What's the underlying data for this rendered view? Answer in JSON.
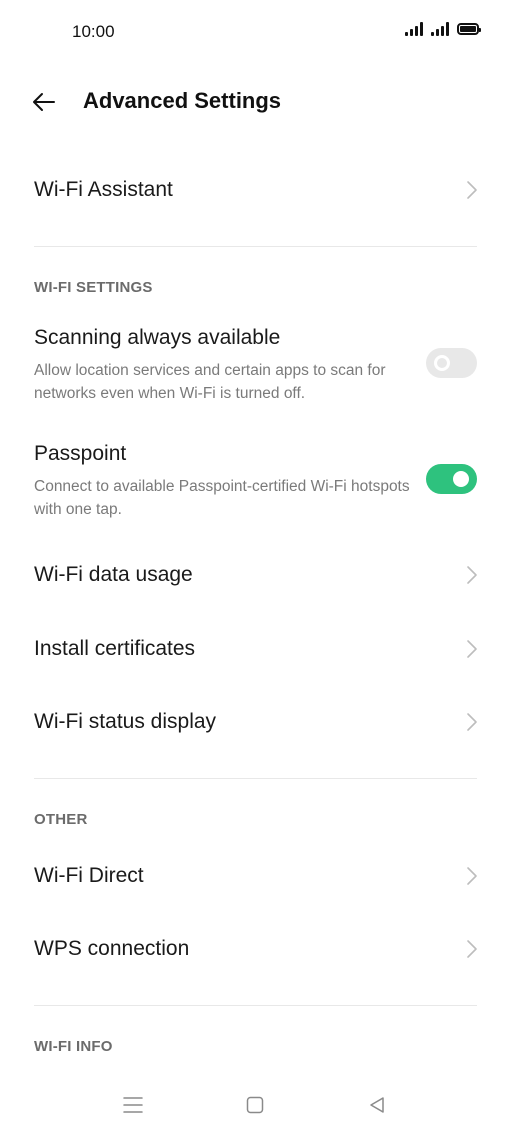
{
  "status_bar": {
    "time": "10:00"
  },
  "header": {
    "title": "Advanced Settings"
  },
  "wifi_assistant": {
    "label": "Wi-Fi Assistant"
  },
  "sections": {
    "wifi_settings": "WI-FI SETTINGS",
    "other": "OTHER",
    "wifi_info": "WI-FI INFO"
  },
  "scanning": {
    "title": "Scanning always available",
    "description": "Allow location services and certain apps to scan for networks even when Wi-Fi is turned off.",
    "enabled": false
  },
  "passpoint": {
    "title": "Passpoint",
    "description": "Connect to available Passpoint-certified Wi-Fi hotspots with one tap.",
    "enabled": true
  },
  "wifi_data_usage": {
    "label": "Wi-Fi data usage"
  },
  "install_certificates": {
    "label": "Install certificates"
  },
  "wifi_status_display": {
    "label": "Wi-Fi status display"
  },
  "wifi_direct": {
    "label": "Wi-Fi Direct"
  },
  "wps_connection": {
    "label": "WPS connection"
  },
  "colors": {
    "accent": "#2ec27e",
    "toggle_off": "#e8e8e8"
  },
  "icons": {
    "back": "back-arrow-icon",
    "chevron": "chevron-right-icon",
    "nav_menu": "menu-icon",
    "nav_home": "home-icon",
    "nav_back": "back-triangle-icon"
  }
}
